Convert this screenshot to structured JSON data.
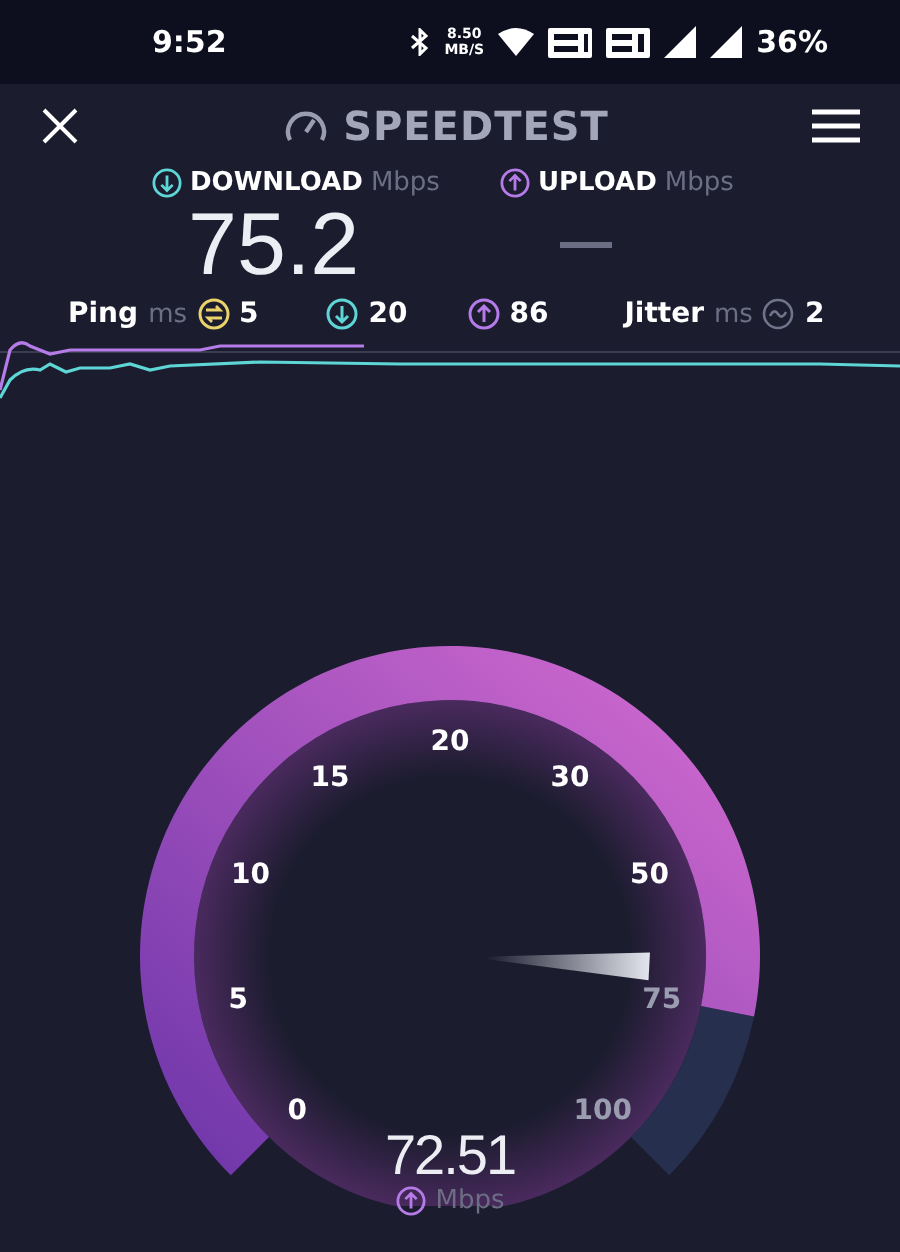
{
  "status_bar": {
    "time": "9:52",
    "net_speed": "8.50",
    "net_unit": "MB/S",
    "battery": "36%"
  },
  "header": {
    "title": "SPEEDTEST"
  },
  "results": [
    {
      "kind": "download",
      "label": "DOWNLOAD",
      "unit": "Mbps",
      "value": "75.2"
    },
    {
      "kind": "upload",
      "label": "UPLOAD",
      "unit": "Mbps"
    }
  ],
  "metrics": [
    {
      "kind": "ping",
      "label": "Ping",
      "unit": "ms",
      "value": "5"
    },
    {
      "kind": "download",
      "value": "20"
    },
    {
      "kind": "upload",
      "value": "86"
    },
    {
      "kind": "jitter",
      "label": "Jitter",
      "unit": "ms",
      "value": "2"
    }
  ],
  "gauge": {
    "ticks": [
      "0",
      "5",
      "10",
      "15",
      "20",
      "30",
      "50",
      "75",
      "100"
    ],
    "reading": "72.51",
    "unit": "Mbps"
  }
}
